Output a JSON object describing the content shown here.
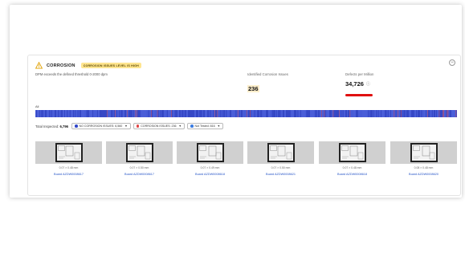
{
  "card": {
    "title": "CORROSION",
    "badge": "CORROSION ISSUES LEVEL IS HIGH",
    "subtitle": "DPM exceeds the defined threshold 0-2000 dpm",
    "collapse_symbol": "−"
  },
  "metrics": {
    "identified": {
      "label": "Identified Corrosion Issues",
      "value": "236"
    },
    "dpm": {
      "label": "Defects per Million",
      "value": "34,726",
      "info": "ⓘ"
    }
  },
  "strip": {
    "label": "All",
    "base_color": "#3b4fd0",
    "defect_color": "#e25555"
  },
  "filters": {
    "total_label": "Total Inspected:",
    "total_value": "6,796",
    "chips": [
      {
        "label": "NO CORROSION ISSUES: 6,560",
        "color": "#3046c8"
      },
      {
        "label": "CORROSION ISSUES: 236",
        "color": "#e04444"
      },
      {
        "label": "Not Tested: 816",
        "color": "#3a7be0"
      }
    ]
  },
  "boards": [
    {
      "measure": "0.07 × 0.48 mm",
      "name": "Board AZDW0008617"
    },
    {
      "measure": "0.07 × 0.50 mm",
      "name": "Board AZDW0008617"
    },
    {
      "measure": "0.07 × 0.49 mm",
      "name": "Board AZDW0008618"
    },
    {
      "measure": "0.07 × 0.50 mm",
      "name": "Board AZDW0008621"
    },
    {
      "measure": "0.07 × 0.48 mm",
      "name": "Board AZDW0008618"
    },
    {
      "measure": "0.08 × 0.48 mm",
      "name": "Board AZDW0008620"
    }
  ],
  "icons": {
    "warning": "warning-icon",
    "info": "info-icon",
    "caret": "chevron-down-icon"
  }
}
